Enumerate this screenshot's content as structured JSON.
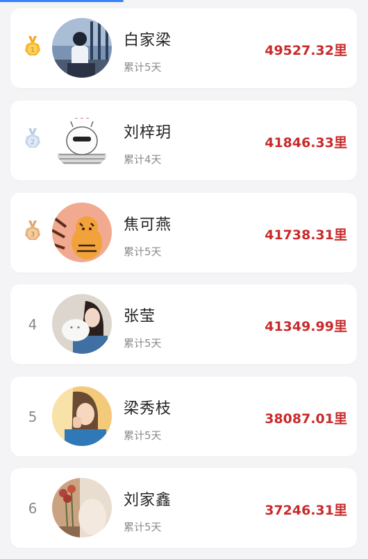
{
  "accent_color": "#3b82f6",
  "distance_color": "#c9292b",
  "ranking": [
    {
      "rank": "1",
      "medal": "gold-medal-icon",
      "name": "白家梁",
      "days": "累计5天",
      "distance": "49527.32里"
    },
    {
      "rank": "2",
      "medal": "silver-medal-icon",
      "name": "刘梓玥",
      "days": "累计4天",
      "distance": "41846.33里"
    },
    {
      "rank": "3",
      "medal": "bronze-medal-icon",
      "name": "焦可燕",
      "days": "累计5天",
      "distance": "41738.31里"
    },
    {
      "rank": "4",
      "name": "张莹",
      "days": "累计5天",
      "distance": "41349.99里"
    },
    {
      "rank": "5",
      "name": "梁秀枝",
      "days": "累计5天",
      "distance": "38087.01里"
    },
    {
      "rank": "6",
      "name": "刘家鑫",
      "days": "累计5天",
      "distance": "37246.31里"
    }
  ]
}
